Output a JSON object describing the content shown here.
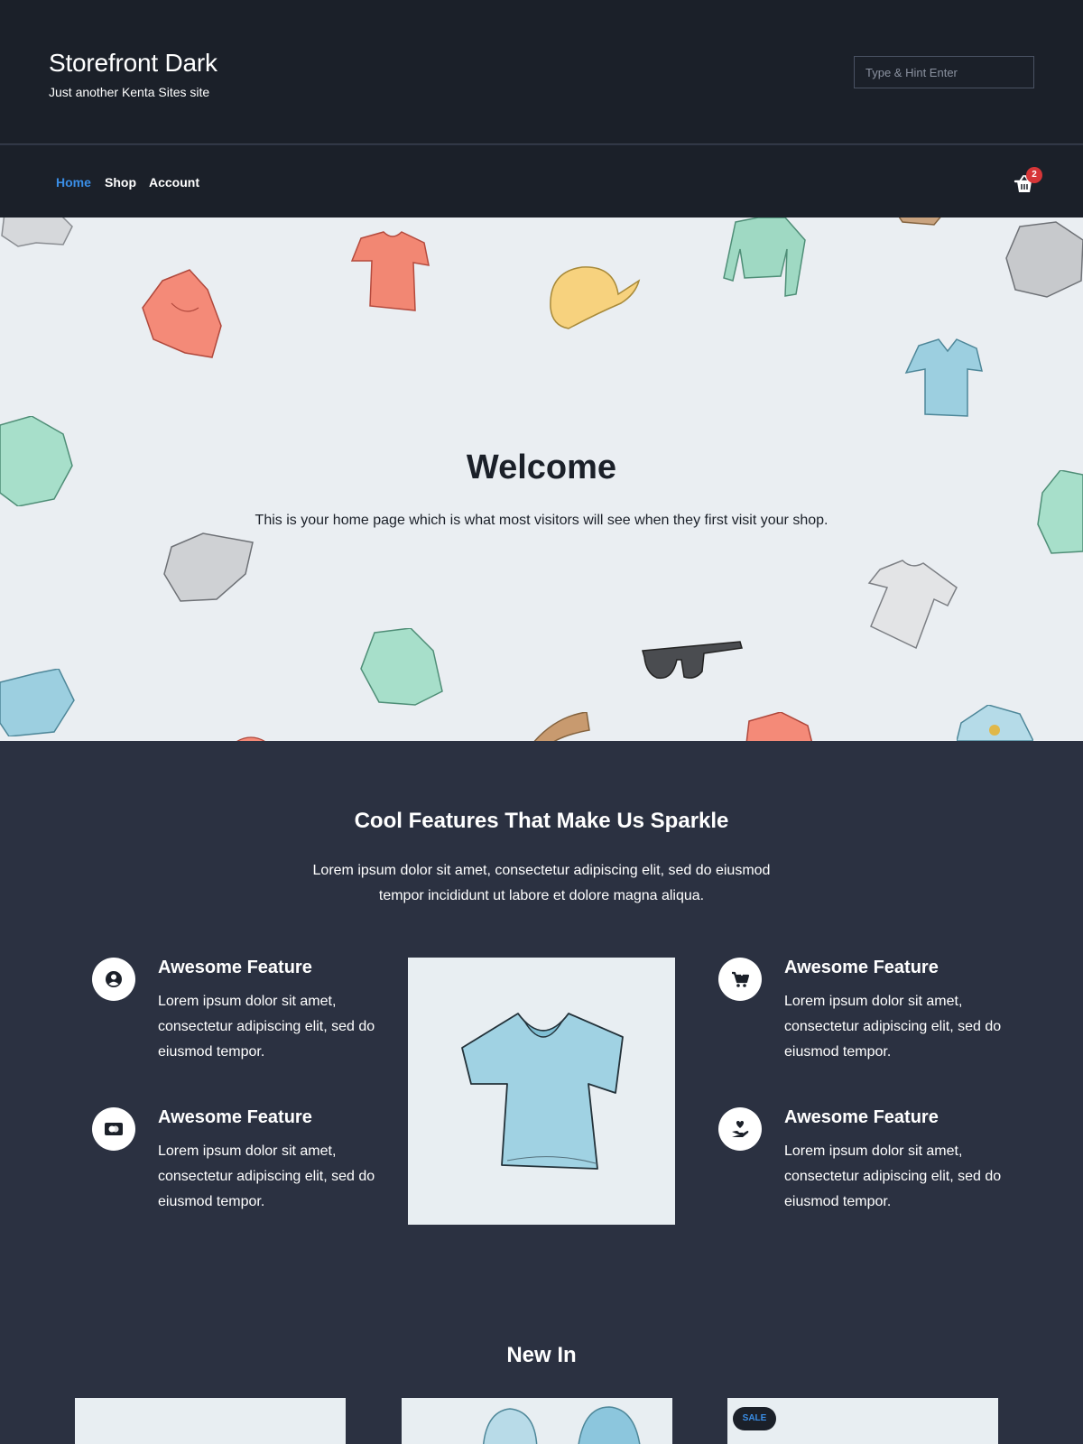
{
  "header": {
    "site_title": "Storefront Dark",
    "tagline": "Just another Kenta Sites site",
    "search_placeholder": "Type & Hint Enter"
  },
  "nav": {
    "items": [
      {
        "label": "Home",
        "active": true
      },
      {
        "label": "Shop",
        "active": false
      },
      {
        "label": "Account",
        "active": false
      }
    ],
    "cart_count": "2"
  },
  "hero": {
    "title": "Welcome",
    "text": "This is your home page which is what most visitors will see when they first visit your shop."
  },
  "features": {
    "heading": "Cool Features That Make Us Sparkle",
    "intro": "Lorem ipsum dolor sit amet, consectetur adipiscing elit, sed do eiusmod tempor incididunt ut labore et dolore magna aliqua.",
    "items": [
      {
        "icon": "user-circle-icon",
        "title": "Awesome Feature",
        "text": "Lorem ipsum dolor sit amet, consectetur adipiscing elit, sed do eiusmod tempor."
      },
      {
        "icon": "shopping-cart-icon",
        "title": "Awesome Feature",
        "text": "Lorem ipsum dolor sit amet, consectetur adipiscing elit, sed do eiusmod tempor."
      },
      {
        "icon": "credit-card-icon",
        "title": "Awesome Feature",
        "text": "Lorem ipsum dolor sit amet, consectetur adipiscing elit, sed do eiusmod tempor."
      },
      {
        "icon": "hand-heart-icon",
        "title": "Awesome Feature",
        "text": "Lorem ipsum dolor sit amet, consectetur adipiscing elit, sed do eiusmod tempor."
      }
    ]
  },
  "new_in": {
    "heading": "New In",
    "sale_badge": "SALE"
  },
  "colors": {
    "header_bg": "#1b2029",
    "body_bg": "#2b3141",
    "hero_bg": "#eaeef2",
    "accent": "#3a8ee6",
    "badge": "#d63638"
  }
}
